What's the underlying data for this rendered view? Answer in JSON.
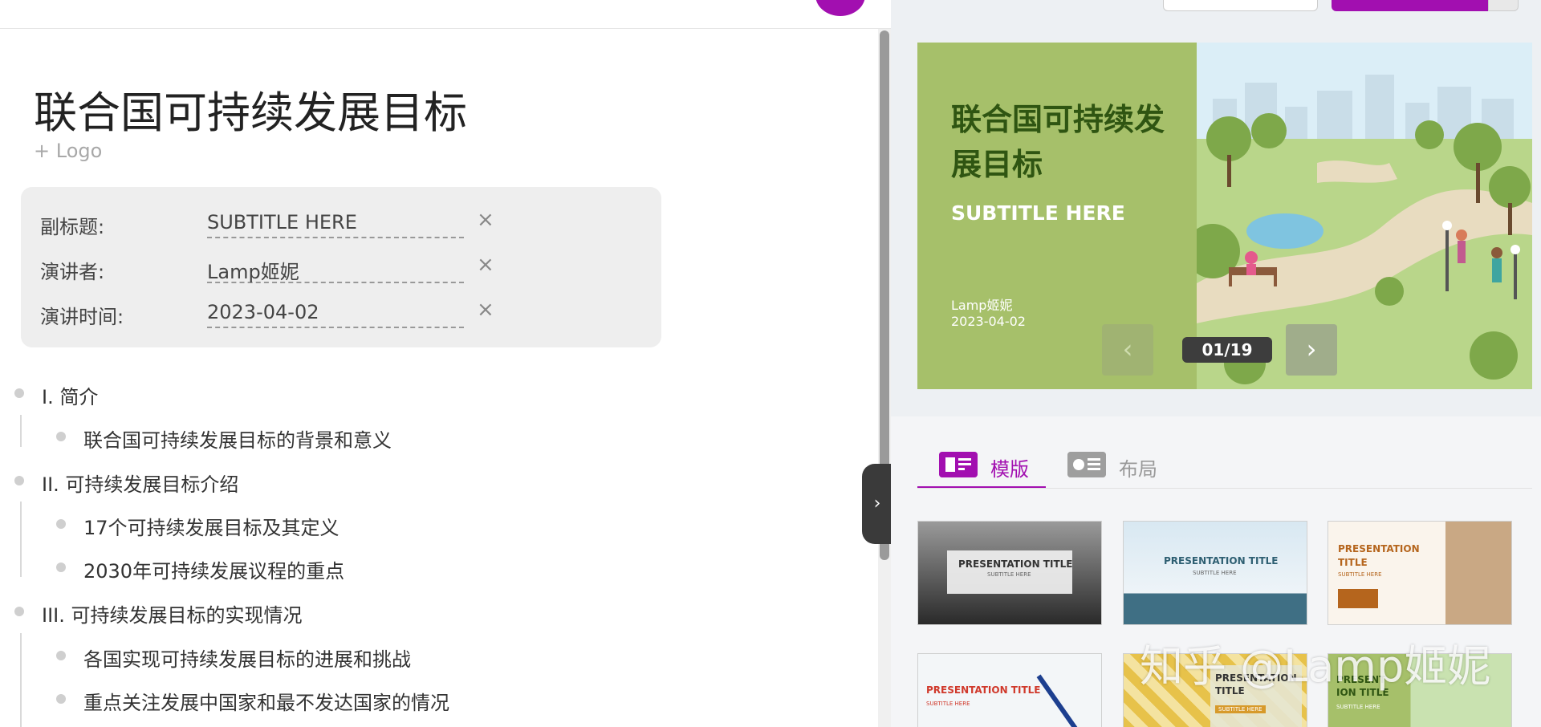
{
  "editor": {
    "title": "联合国可持续发展目标",
    "add_logo": "+ Logo",
    "meta": [
      {
        "label": "副标题:",
        "value": "SUBTITLE HERE",
        "clear": "×"
      },
      {
        "label": "演讲者:",
        "value": "Lamp姬妮",
        "clear": "×"
      },
      {
        "label": "演讲时间:",
        "value": "2023-04-02",
        "clear": "×"
      }
    ],
    "outline": [
      {
        "level": 1,
        "text": "I. 简介"
      },
      {
        "level": 2,
        "text": "联合国可持续发展目标的背景和意义"
      },
      {
        "level": 1,
        "text": "II. 可持续发展目标介绍"
      },
      {
        "level": 2,
        "text": "17个可持续发展目标及其定义"
      },
      {
        "level": 2,
        "text": "2030年可持续发展议程的重点"
      },
      {
        "level": 1,
        "text": "III. 可持续发展目标的实现情况"
      },
      {
        "level": 2,
        "text": "各国实现可持续发展目标的进展和挑战"
      },
      {
        "level": 2,
        "text": "重点关注发展中国家和最不发达国家的情况"
      }
    ],
    "collapse_icon": "›"
  },
  "preview": {
    "title": "联合国可持续发展目标",
    "subtitle": "SUBTITLE HERE",
    "author": "Lamp姬妮",
    "date": "2023-04-02",
    "counter": "01/19",
    "prev_icon": "‹",
    "next_icon": "›",
    "bg_color": "#a6c06a",
    "title_color": "#2f5512"
  },
  "tabs": [
    {
      "label": "模版",
      "icon": "template-icon",
      "active": true
    },
    {
      "label": "布局",
      "icon": "layout-icon",
      "active": false
    }
  ],
  "templates": [
    {
      "title": "PRESENTATION TITLE",
      "subtitle": "SUBTITLE HERE",
      "style": "city-gray"
    },
    {
      "title": "PRESENTATION TITLE",
      "subtitle": "SUBTITLE HERE",
      "style": "sky-blue"
    },
    {
      "title": "PRESENTATION TITLE",
      "subtitle": "SUBTITLE HERE",
      "style": "arch-warm"
    },
    {
      "title": "PRESENTATION TITLE",
      "subtitle": "SUBTITLE HERE",
      "style": "desk-red"
    },
    {
      "title": "PRESENTATION TITLE",
      "subtitle": "SUBTITLE HERE",
      "style": "cubes-yellow"
    },
    {
      "title": "PRESENT ION TITLE",
      "subtitle": "SUBTITLE HERE",
      "style": "park-green"
    }
  ],
  "watermark": "知乎 @Lamp姬妮",
  "accent": "#a20fb0"
}
